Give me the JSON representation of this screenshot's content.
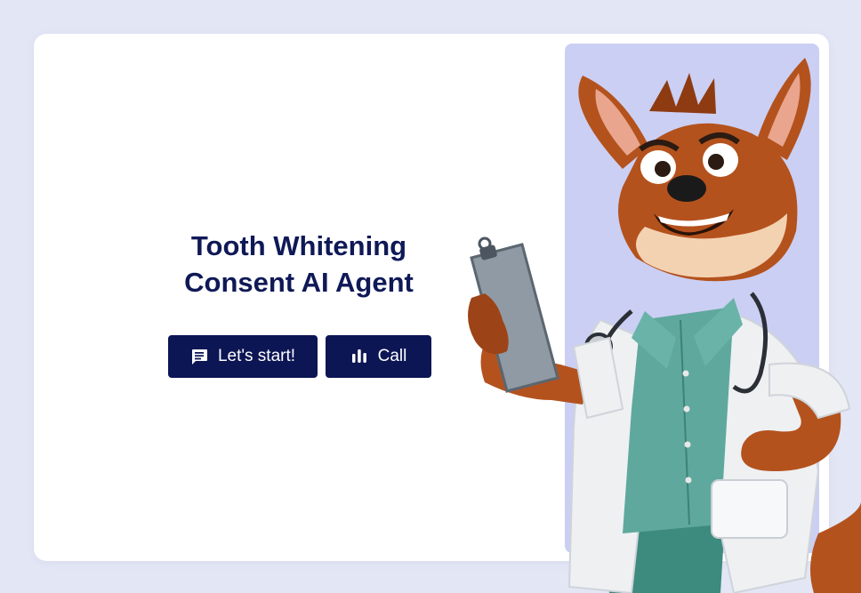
{
  "page": {
    "title_line_1": "Tooth Whitening",
    "title_line_2": "Consent AI Agent"
  },
  "actions": {
    "start_label": "Let's start!",
    "start_icon": "chat-bubble-icon",
    "call_label": "Call",
    "call_icon": "audio-bars-icon"
  },
  "colors": {
    "background": "#e3e6f5",
    "card": "#ffffff",
    "accent_panel": "#cbcff3",
    "primary": "#0d1654",
    "title": "#0f1957"
  }
}
